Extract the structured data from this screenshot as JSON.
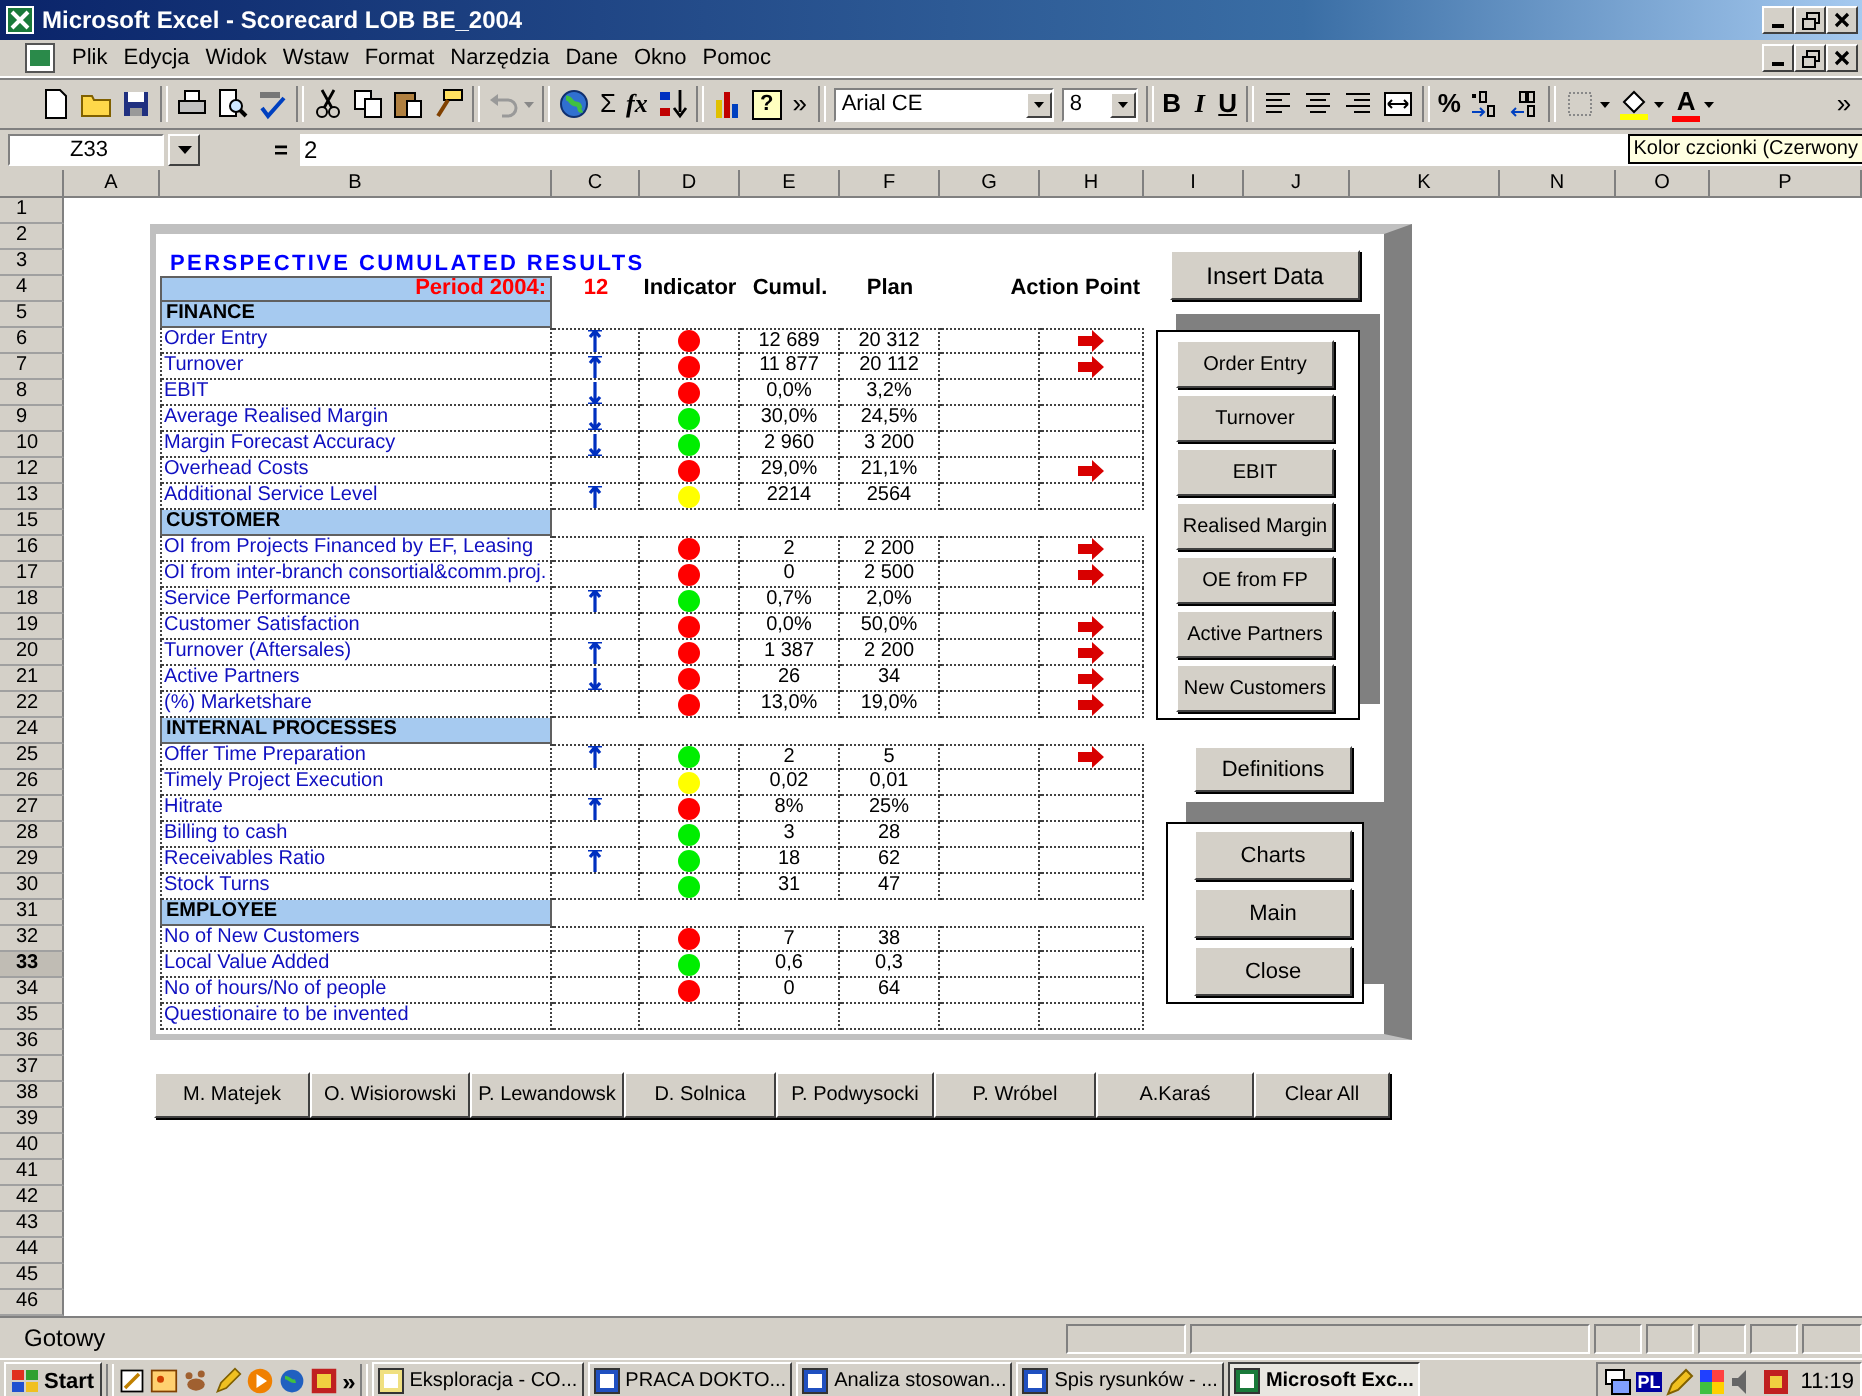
{
  "window": {
    "title": "Microsoft Excel - Scorecard LOB BE_2004"
  },
  "menu": [
    "Plik",
    "Edycja",
    "Widok",
    "Wstaw",
    "Format",
    "Narzędzia",
    "Dane",
    "Okno",
    "Pomoc"
  ],
  "toolbar": {
    "sum": "Σ",
    "function": "fx",
    "help": "?",
    "overflow": "»",
    "font": "Arial CE",
    "size": "8",
    "bold": "B",
    "italic": "I",
    "underline": "U",
    "percent": "%",
    "font_color": "A",
    "overflow_right": "»"
  },
  "tooltip": "Kolor czcionki (Czerwony",
  "formula_bar": {
    "name_box": "Z33",
    "equals": "=",
    "value": "2"
  },
  "columns": [
    "A",
    "B",
    "C",
    "D",
    "E",
    "F",
    "G",
    "H",
    "I",
    "J",
    "K",
    "N",
    "O",
    "P"
  ],
  "rows": [
    {
      "label": "1",
      "selected": false
    },
    {
      "label": "2",
      "selected": false
    },
    {
      "label": "3",
      "selected": false
    },
    {
      "label": "4",
      "selected": false
    },
    {
      "label": "5",
      "selected": false
    },
    {
      "label": "6",
      "selected": false
    },
    {
      "label": "7",
      "selected": false
    },
    {
      "label": "8",
      "selected": false
    },
    {
      "label": "9",
      "selected": false
    },
    {
      "label": "10",
      "selected": false
    },
    {
      "label": "12",
      "selected": false
    },
    {
      "label": "13",
      "selected": false
    },
    {
      "label": "15",
      "selected": false
    },
    {
      "label": "16",
      "selected": false
    },
    {
      "label": "17",
      "selected": false
    },
    {
      "label": "18",
      "selected": false
    },
    {
      "label": "19",
      "selected": false
    },
    {
      "label": "20",
      "selected": false
    },
    {
      "label": "21",
      "selected": false
    },
    {
      "label": "22",
      "selected": false
    },
    {
      "label": "24",
      "selected": false
    },
    {
      "label": "25",
      "selected": false
    },
    {
      "label": "26",
      "selected": false
    },
    {
      "label": "27",
      "selected": false
    },
    {
      "label": "28",
      "selected": false
    },
    {
      "label": "29",
      "selected": false
    },
    {
      "label": "30",
      "selected": false
    },
    {
      "label": "31",
      "selected": false
    },
    {
      "label": "32",
      "selected": false
    },
    {
      "label": "33",
      "selected": true
    },
    {
      "label": "34",
      "selected": false
    },
    {
      "label": "35",
      "selected": false
    },
    {
      "label": "36",
      "selected": false
    },
    {
      "label": "37",
      "selected": false
    },
    {
      "label": "38",
      "selected": false
    },
    {
      "label": "39",
      "selected": false
    },
    {
      "label": "40",
      "selected": false
    },
    {
      "label": "41",
      "selected": false
    },
    {
      "label": "42",
      "selected": false
    },
    {
      "label": "43",
      "selected": false
    },
    {
      "label": "44",
      "selected": false
    },
    {
      "label": "45",
      "selected": false
    },
    {
      "label": "46",
      "selected": false
    }
  ],
  "scorecard": {
    "title": "PERSPECTIVE CUMULATED RESULTS",
    "period_label": "Period 2004:",
    "period_value": "12",
    "headers": {
      "indicator": "Indicator",
      "cumul": "Cumul.",
      "plan": "Plan",
      "action": "Action Point"
    },
    "sections": [
      {
        "title": "FINANCE",
        "items": [
          {
            "label": "Order Entry",
            "kind": "rising",
            "color": "#ff0000",
            "cumul": "12 689",
            "plan": "20 312",
            "action": true
          },
          {
            "label": "Turnover",
            "kind": "rising",
            "color": "#ff0000",
            "cumul": "11 877",
            "plan": "20 112",
            "action": true
          },
          {
            "label": "EBIT",
            "kind": "falling",
            "color": "#ff0000",
            "cumul": "0,0%",
            "plan": "3,2%",
            "action": false
          },
          {
            "label": "Average Realised Margin",
            "kind": "falling",
            "color": "#00ee00",
            "cumul": "30,0%",
            "plan": "24,5%",
            "action": false
          },
          {
            "label": "Margin Forecast Accuracy",
            "kind": "falling",
            "color": "#00ee00",
            "cumul": "2 960",
            "plan": "3 200",
            "action": false
          },
          {
            "label": "Overhead Costs",
            "kind": "flat",
            "color": "#ff0000",
            "cumul": "29,0%",
            "plan": "21,1%",
            "action": true
          },
          {
            "label": "Additional Service Level",
            "kind": "rising",
            "color": "#ffff00",
            "cumul": "2214",
            "plan": "2564",
            "action": false
          }
        ]
      },
      {
        "title": "CUSTOMER",
        "items": [
          {
            "label": "OI from Projects Financed by EF, Leasing",
            "kind": "flat",
            "color": "#ff0000",
            "cumul": "2",
            "plan": "2 200",
            "action": true
          },
          {
            "label": "OI from inter-branch consortial&comm.proj.",
            "kind": "flat",
            "color": "#ff0000",
            "cumul": "0",
            "plan": "2 500",
            "action": true
          },
          {
            "label": "Service Performance",
            "kind": "rising",
            "color": "#00ee00",
            "cumul": "0,7%",
            "plan": "2,0%",
            "action": false
          },
          {
            "label": "Customer Satisfaction",
            "kind": "flat",
            "color": "#ff0000",
            "cumul": "0,0%",
            "plan": "50,0%",
            "action": true
          },
          {
            "label": "Turnover (Aftersales)",
            "kind": "rising",
            "color": "#ff0000",
            "cumul": "1 387",
            "plan": "2 200",
            "action": true
          },
          {
            "label": "Active Partners",
            "kind": "falling",
            "color": "#ff0000",
            "cumul": "26",
            "plan": "34",
            "action": true
          },
          {
            "label": "(%) Marketshare",
            "kind": "flat",
            "color": "#ff0000",
            "cumul": "13,0%",
            "plan": "19,0%",
            "action": true
          }
        ]
      },
      {
        "title": "INTERNAL PROCESSES",
        "items": [
          {
            "label": "Offer Time Preparation",
            "kind": "rising",
            "color": "#00ee00",
            "cumul": "2",
            "plan": "5",
            "action": true
          },
          {
            "label": "Timely Project Execution",
            "kind": "flat",
            "color": "#ffff00",
            "cumul": "0,02",
            "plan": "0,01",
            "action": false
          },
          {
            "label": "Hitrate",
            "kind": "rising",
            "color": "#ff0000",
            "cumul": "8%",
            "plan": "25%",
            "action": false
          },
          {
            "label": "Billing to cash",
            "kind": "flat",
            "color": "#00ee00",
            "cumul": "3",
            "plan": "28",
            "action": false
          },
          {
            "label": "Receivables Ratio",
            "kind": "rising",
            "color": "#00ee00",
            "cumul": "18",
            "plan": "62",
            "action": false
          },
          {
            "label": "Stock Turns",
            "kind": "flat",
            "color": "#00ee00",
            "cumul": "31",
            "plan": "47",
            "action": false
          }
        ]
      },
      {
        "title": "EMPLOYEE",
        "items": [
          {
            "label": "No of New Customers",
            "kind": "flat",
            "color": "#ff0000",
            "cumul": "7",
            "plan": "38",
            "action": false
          },
          {
            "label": "Local Value Added",
            "kind": "flat",
            "color": "#00ee00",
            "cumul": "0,6",
            "plan": "0,3",
            "action": false
          },
          {
            "label": "No of hours/No of people",
            "kind": "flat",
            "color": "#ff0000",
            "cumul": "0",
            "plan": "64",
            "action": false
          },
          {
            "label": "Questionaire to be invented",
            "kind": "flat",
            "action": false
          }
        ]
      }
    ]
  },
  "side_buttons": {
    "top": "Insert Data",
    "group1": [
      "Order Entry",
      "Turnover",
      "EBIT",
      "Realised Margin",
      "OE from FP",
      "Active Partners",
      "New Customers"
    ],
    "middle": "Definitions",
    "group2": [
      "Charts",
      "Main",
      "Close"
    ]
  },
  "name_buttons": [
    "M. Matejek",
    "O. Wisiorowski",
    "P. Lewandowsk",
    "D. Solnica",
    "P. Podwysocki",
    "P. Wróbel",
    "A.Karaś",
    "Clear All"
  ],
  "status_bar": {
    "text": "Gotowy"
  },
  "taskbar": {
    "start": "Start",
    "overflow": "»",
    "tasks": [
      {
        "label": "Eksploracja - CO...",
        "selected": false
      },
      {
        "label": "PRACA DOKTO...",
        "selected": false
      },
      {
        "label": "Analiza stosowan...",
        "selected": false
      },
      {
        "label": "Spis rysunków - ...",
        "selected": false
      },
      {
        "label": "Microsoft Exc...",
        "selected": true
      }
    ],
    "language": "PL",
    "clock": "11:19"
  }
}
